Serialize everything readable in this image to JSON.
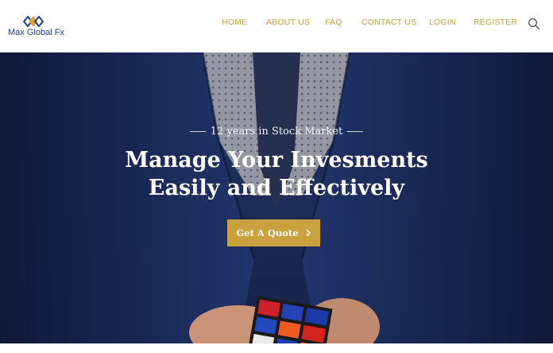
{
  "header": {
    "logo_text": "Max Global Fx",
    "nav": [
      {
        "label": "HOME"
      },
      {
        "label": "ABOUT US"
      },
      {
        "label": "FAQ"
      },
      {
        "label": "CONTACT US"
      },
      {
        "label": "LOGIN"
      },
      {
        "label": "REGISTER"
      }
    ],
    "search_icon": "search-icon"
  },
  "hero": {
    "kicker": "12 years in Stock Market",
    "headline_line1": "Manage Your Invesments",
    "headline_line2": "Easily and Effectively",
    "cta_label": "Get A Quote",
    "cta_icon": "chevron-right-icon"
  },
  "colors": {
    "accent_gold": "#c9a13f",
    "logo_blue": "#1d3f8f",
    "hero_navy": "#1e2d5c"
  }
}
